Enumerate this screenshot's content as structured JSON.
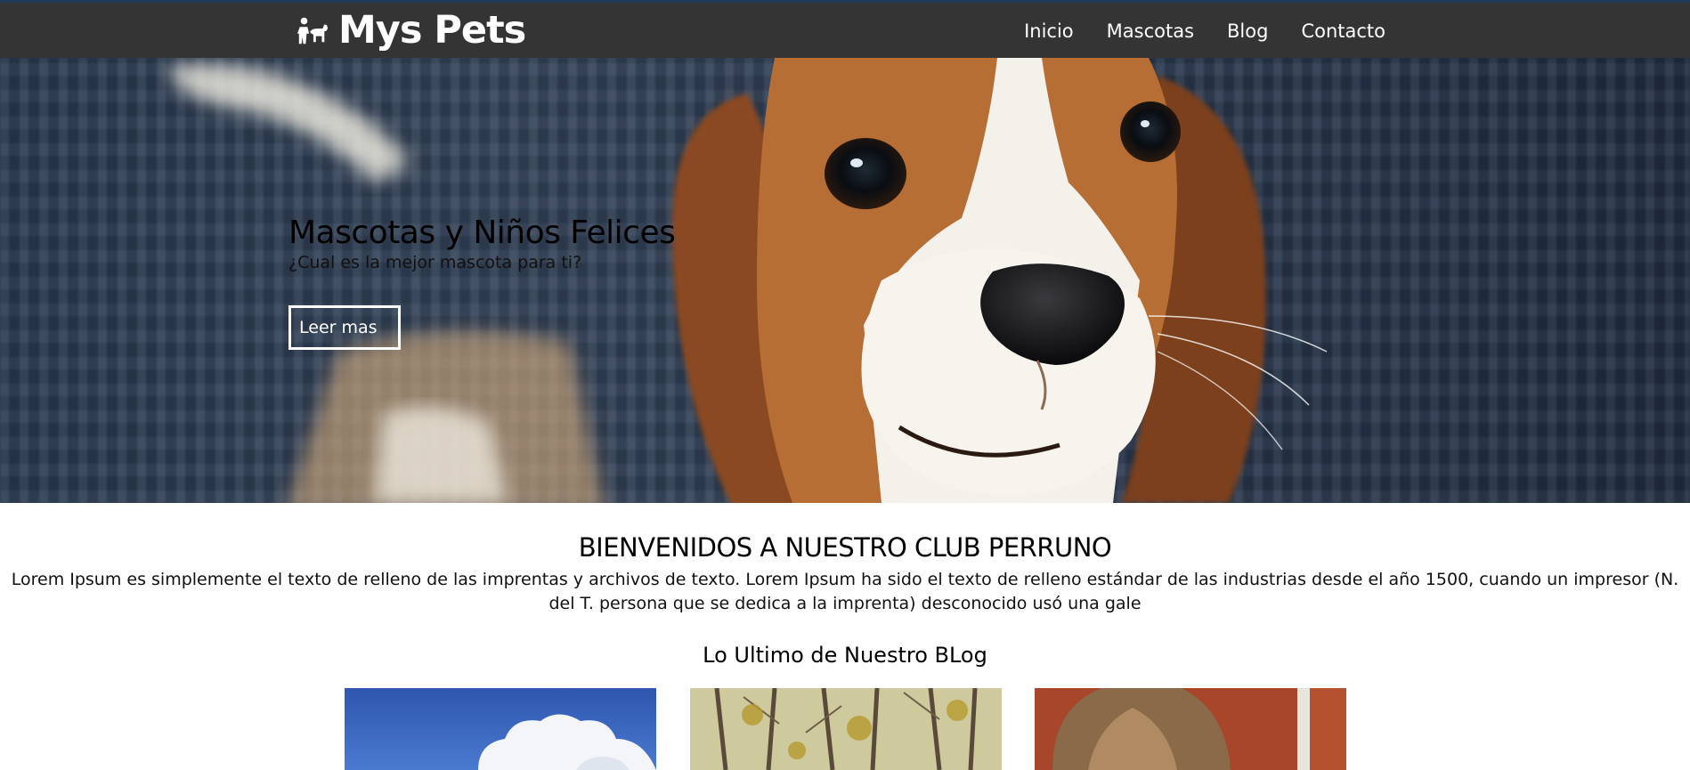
{
  "header": {
    "logo_text": "Mys Pets",
    "logo_icon": "pets-icon",
    "nav": [
      {
        "label": "Inicio"
      },
      {
        "label": "Mascotas"
      },
      {
        "label": "Blog"
      },
      {
        "label": "Contacto"
      }
    ]
  },
  "hero": {
    "title": "Mascotas y Niños Felices",
    "subtitle": "¿Cual es la mejor mascota para ti?",
    "button_label": "Leer mas"
  },
  "welcome": {
    "title": "BIENVENIDOS A NUESTRO CLUB PERRUNO",
    "text": "Lorem Ipsum es simplemente el texto de relleno de las imprentas y archivos de texto. Lorem Ipsum ha sido el texto de relleno estándar de las industrias desde el año 1500, cuando un impresor (N. del T. persona que se dedica a la imprenta) desconocido usó una gale"
  },
  "blog": {
    "title": "Lo Ultimo de Nuestro BLog"
  },
  "colors": {
    "header_bg": "#343434",
    "header_top_border": "#1f3a5a",
    "hero_bg": "#2c3a50"
  }
}
